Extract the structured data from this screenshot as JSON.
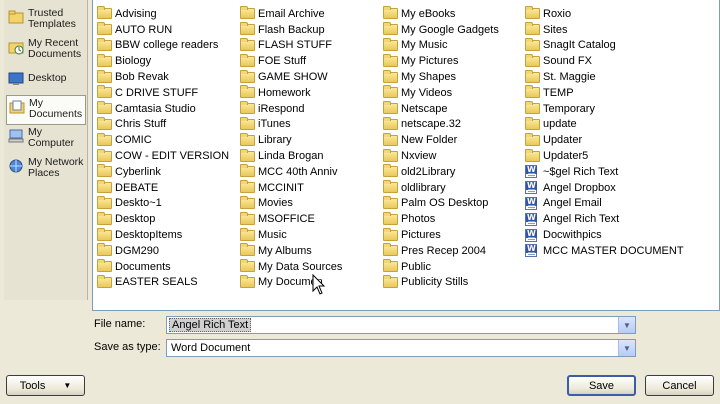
{
  "places": [
    {
      "label": "Trusted Templates",
      "icon": "trusted-templates-icon"
    },
    {
      "label": "My Recent Documents",
      "icon": "recent-documents-icon"
    },
    {
      "label": "Desktop",
      "icon": "desktop-icon"
    },
    {
      "label": "My Documents",
      "icon": "my-documents-icon"
    },
    {
      "label": "My Computer",
      "icon": "my-computer-icon"
    },
    {
      "label": "My Network Places",
      "icon": "network-places-icon"
    }
  ],
  "columns": [
    [
      {
        "name": "Advising",
        "type": "folder"
      },
      {
        "name": "AUTO RUN",
        "type": "folder"
      },
      {
        "name": "BBW college readers",
        "type": "folder"
      },
      {
        "name": "Biology",
        "type": "folder"
      },
      {
        "name": "Bob Revak",
        "type": "folder"
      },
      {
        "name": "C DRIVE STUFF",
        "type": "folder"
      },
      {
        "name": "Camtasia Studio",
        "type": "folder"
      },
      {
        "name": "Chris Stuff",
        "type": "folder"
      },
      {
        "name": "COMIC",
        "type": "folder"
      },
      {
        "name": "COW - EDIT VERSION",
        "type": "folder"
      },
      {
        "name": "Cyberlink",
        "type": "folder"
      },
      {
        "name": "DEBATE",
        "type": "folder"
      },
      {
        "name": "Deskto~1",
        "type": "folder"
      },
      {
        "name": "Desktop",
        "type": "folder"
      },
      {
        "name": "DesktopItems",
        "type": "folder"
      },
      {
        "name": "DGM290",
        "type": "folder"
      },
      {
        "name": "Documents",
        "type": "folder"
      },
      {
        "name": "EASTER SEALS",
        "type": "folder"
      }
    ],
    [
      {
        "name": "Email Archive",
        "type": "folder"
      },
      {
        "name": "Flash Backup",
        "type": "folder"
      },
      {
        "name": "FLASH STUFF",
        "type": "folder"
      },
      {
        "name": "FOE Stuff",
        "type": "folder"
      },
      {
        "name": "GAME SHOW",
        "type": "folder"
      },
      {
        "name": "Homework",
        "type": "folder"
      },
      {
        "name": "iRespond",
        "type": "folder"
      },
      {
        "name": "iTunes",
        "type": "folder"
      },
      {
        "name": "Library",
        "type": "folder"
      },
      {
        "name": "Linda Brogan",
        "type": "folder"
      },
      {
        "name": "MCC 40th Anniv",
        "type": "folder"
      },
      {
        "name": "MCCINIT",
        "type": "folder"
      },
      {
        "name": "Movies",
        "type": "folder"
      },
      {
        "name": "MSOFFICE",
        "type": "folder"
      },
      {
        "name": "Music",
        "type": "folder"
      },
      {
        "name": "My Albums",
        "type": "folder"
      },
      {
        "name": "My Data Sources",
        "type": "folder"
      },
      {
        "name": "My Documen",
        "type": "folder"
      }
    ],
    [
      {
        "name": "My eBooks",
        "type": "folder"
      },
      {
        "name": "My Google Gadgets",
        "type": "folder"
      },
      {
        "name": "My Music",
        "type": "folder"
      },
      {
        "name": "My Pictures",
        "type": "folder"
      },
      {
        "name": "My Shapes",
        "type": "folder"
      },
      {
        "name": "My Videos",
        "type": "folder"
      },
      {
        "name": "Netscape",
        "type": "folder"
      },
      {
        "name": "netscape.32",
        "type": "folder"
      },
      {
        "name": "New Folder",
        "type": "folder"
      },
      {
        "name": "Nxview",
        "type": "folder"
      },
      {
        "name": "old2Library",
        "type": "folder"
      },
      {
        "name": "oldlibrary",
        "type": "folder"
      },
      {
        "name": "Palm OS Desktop",
        "type": "folder"
      },
      {
        "name": "Photos",
        "type": "folder"
      },
      {
        "name": "Pictures",
        "type": "folder"
      },
      {
        "name": "Pres Recep 2004",
        "type": "folder"
      },
      {
        "name": "Public",
        "type": "folder"
      },
      {
        "name": "Publicity Stills",
        "type": "folder"
      }
    ],
    [
      {
        "name": "Roxio",
        "type": "folder"
      },
      {
        "name": "Sites",
        "type": "folder"
      },
      {
        "name": "SnagIt Catalog",
        "type": "folder"
      },
      {
        "name": "Sound FX",
        "type": "folder"
      },
      {
        "name": "St. Maggie",
        "type": "folder"
      },
      {
        "name": "TEMP",
        "type": "folder"
      },
      {
        "name": "Temporary",
        "type": "folder"
      },
      {
        "name": "update",
        "type": "folder"
      },
      {
        "name": "Updater",
        "type": "folder"
      },
      {
        "name": "Updater5",
        "type": "folder"
      },
      {
        "name": "~$gel Rich Text",
        "type": "doc"
      },
      {
        "name": "Angel Dropbox",
        "type": "doc"
      },
      {
        "name": "Angel Email",
        "type": "doc"
      },
      {
        "name": "Angel Rich Text",
        "type": "doc"
      },
      {
        "name": "Docwithpics",
        "type": "doc"
      },
      {
        "name": "MCC MASTER DOCUMENT",
        "type": "doc"
      }
    ]
  ],
  "form": {
    "file_name_label": "File name:",
    "file_name_value": "Angel Rich Text",
    "save_type_label": "Save as type:",
    "save_type_value": "Word Document"
  },
  "buttons": {
    "tools": "Tools",
    "save": "Save",
    "cancel": "Cancel"
  },
  "colors": {
    "dialog_bg": "#ece9d8",
    "list_border": "#7f9db9",
    "default_button_border": "#3a5ea6"
  }
}
